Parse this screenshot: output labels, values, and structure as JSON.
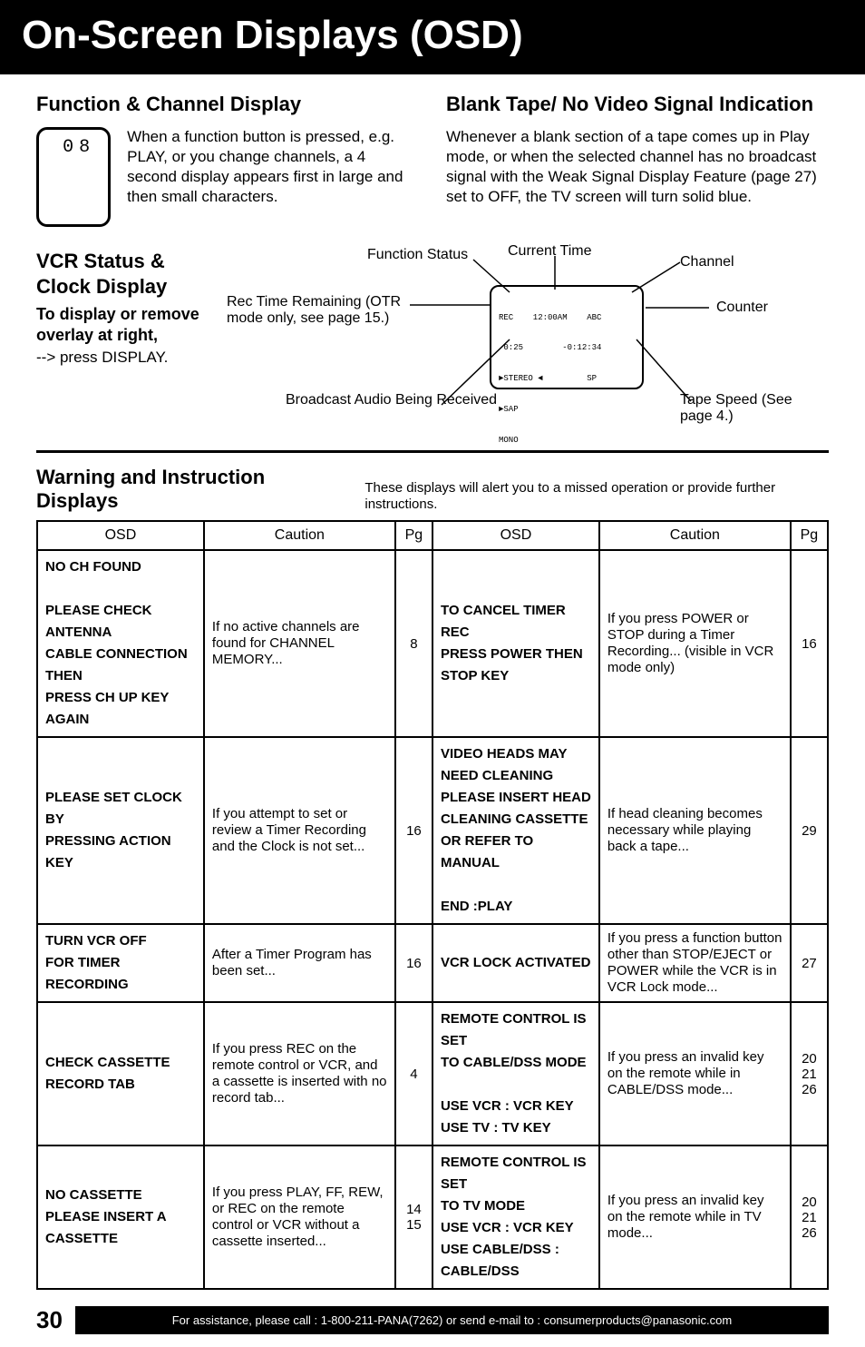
{
  "banner": "On-Screen Displays (OSD)",
  "func": {
    "heading": "Function & Channel Display",
    "tv_value": "08",
    "text": "When a function button is pressed, e.g. PLAY, or you change channels, a 4 second display appears first in large and then small characters."
  },
  "blank": {
    "heading": "Blank Tape/ No Video Signal Indication",
    "text": "Whenever a blank section of a tape comes up in Play mode, or when the selected channel has no broadcast signal with the Weak Signal Display Feature (page 27) set to OFF, the TV screen will turn solid blue."
  },
  "vcr": {
    "heading": "VCR Status & Clock Display",
    "sub": "To display or remove overlay at right,",
    "press": "--> press DISPLAY.",
    "rec_remaining": "Rec Time Remaining (OTR mode only, see page 15.)",
    "broadcast": "Broadcast Audio Being Received",
    "labels": {
      "function_status": "Function Status",
      "current_time": "Current Time",
      "channel": "Channel",
      "counter": "Counter",
      "tape_speed": "Tape Speed (See page 4.)"
    },
    "osd": {
      "line1": "REC    12:00AM    ABC",
      "line2": " 0:25        -0:12:34",
      "line3": "►STEREO ◄         SP",
      "line4": "►SAP",
      "line5": "MONO"
    }
  },
  "warn": {
    "heading": "Warning and Instruction Displays",
    "note": "These displays will alert you to a missed operation or provide further instructions.",
    "headers": {
      "osd": "OSD",
      "caution": "Caution",
      "pg": "Pg"
    },
    "rows_left": [
      {
        "osd": "NO CH FOUND\n\nPLEASE CHECK ANTENNA\nCABLE CONNECTION THEN\nPRESS CH UP KEY AGAIN",
        "caution": "If no active channels are found for CHANNEL MEMORY...",
        "pg": "8"
      },
      {
        "osd": "PLEASE SET CLOCK BY\nPRESSING ACTION KEY",
        "caution": "If you attempt to set or review a Timer Recording and the Clock is not set...",
        "pg": "16"
      },
      {
        "osd": "TURN VCR OFF\nFOR TIMER RECORDING",
        "caution": "After a Timer Program has been set...",
        "pg": "16"
      },
      {
        "osd": "CHECK CASSETTE\nRECORD TAB",
        "caution": "If you press REC on the remote control or VCR, and a cassette is inserted with no record tab...",
        "pg": "4"
      },
      {
        "osd": "NO CASSETTE\nPLEASE INSERT A CASSETTE",
        "caution": "If you press PLAY, FF, REW, or REC on the remote control or VCR without a cassette inserted...",
        "pg": "14\n15"
      }
    ],
    "rows_right": [
      {
        "osd": "TO CANCEL TIMER REC\nPRESS POWER THEN\nSTOP KEY",
        "caution": "If you press POWER or STOP during a Timer Recording... (visible in VCR mode only)",
        "pg": "16"
      },
      {
        "osd": "VIDEO HEADS MAY\nNEED CLEANING\nPLEASE INSERT HEAD\nCLEANING CASSETTE\nOR REFER TO MANUAL\n\nEND    :PLAY",
        "caution": "If head cleaning becomes necessary while playing back a tape...",
        "pg": "29"
      },
      {
        "osd": "VCR LOCK ACTIVATED",
        "caution": "If you press a function button other than STOP/EJECT or POWER while the VCR is in VCR Lock mode...",
        "pg": "27"
      },
      {
        "osd": "REMOTE CONTROL IS SET\nTO CABLE/DSS MODE\n\nUSE VCR :  VCR KEY\nUSE TV  :  TV KEY",
        "caution": "If you press an invalid key on the remote while in CABLE/DSS mode...",
        "pg": "20\n21\n26"
      },
      {
        "osd": "REMOTE CONTROL IS SET\nTO TV MODE\nUSE VCR : VCR KEY\nUSE CABLE/DSS : CABLE/DSS",
        "caution": "If you press an invalid key on the remote while in TV mode...",
        "pg": "20\n21\n26"
      }
    ]
  },
  "footer": {
    "page_number": "30",
    "assist": "For assistance, please call : 1-800-211-PANA(7262) or send e-mail to : consumerproducts@panasonic.com"
  }
}
